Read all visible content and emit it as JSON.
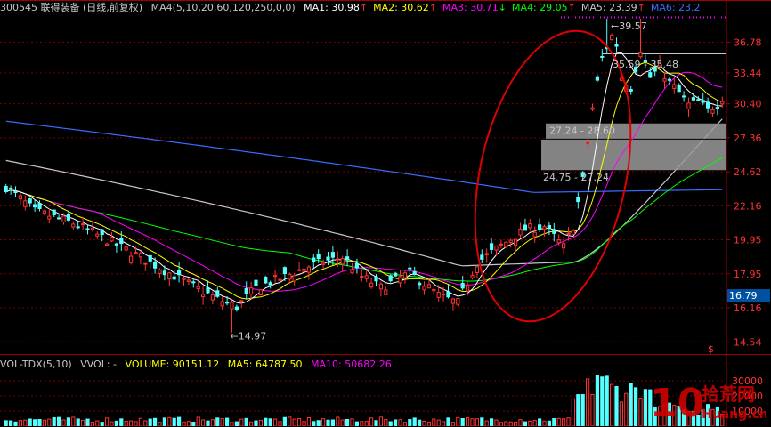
{
  "header": {
    "stock": "300545 联得装备 (日线,前复权)",
    "ma_label": "MA4(5,10,20,60,120,250,0,0)",
    "ma": [
      {
        "text": "MA1: 30.98",
        "arrow": "↑",
        "color": "#ffffff"
      },
      {
        "text": "MA2: 30.62",
        "arrow": "↑",
        "color": "#ffff00"
      },
      {
        "text": "MA3: 30.71",
        "arrow": "↓",
        "color": "#ff00ff"
      },
      {
        "text": "MA4: 29.05",
        "arrow": "↑",
        "color": "#00ff00"
      },
      {
        "text": "MA5: 23.39",
        "arrow": "↑",
        "color": "#c8c8c8"
      },
      {
        "text": "MA6: 23.2",
        "arrow": "",
        "color": "#3a6cff"
      }
    ]
  },
  "volume_header": {
    "label": "VOL-TDX(5,10)",
    "vvol": "VVOL: -",
    "volume": "VOLUME: 90151.12",
    "ma5": "MA5: 64787.50",
    "ma10": "MA10: 50682.26"
  },
  "price_axis": {
    "ticks": [
      "36.78",
      "33.44",
      "30.40",
      "27.36",
      "24.62",
      "22.16",
      "19.95",
      "17.95",
      "16.16",
      "14.54"
    ],
    "current": "16.79",
    "unit": "$"
  },
  "volume_axis": {
    "ticks": [
      "30000",
      "20000",
      "10000"
    ]
  },
  "annotations": {
    "high": "39.57",
    "low": "14.97",
    "zone1": "35.59 - 35.48",
    "zone2": "27.24 - 28.60",
    "zone3": "24.75 - 27.24"
  },
  "watermark": {
    "text": "拾荒网",
    "sub": "Huang.cn"
  },
  "colors": {
    "up": "#ff3232",
    "down": "#54ffff",
    "grid": "#7a0000",
    "circle": "#e00000"
  },
  "chart_data": {
    "type": "candlestick",
    "title": "300545 联得装备 (日线,前复权)",
    "ylim": [
      14.0,
      40.0
    ],
    "y_scale": "log",
    "ohlc_summary": {
      "low_point": 14.97,
      "high_point": 39.57,
      "last_close": 30.98
    },
    "moving_averages": {
      "MA5": 30.98,
      "MA10": 30.62,
      "MA20": 30.71,
      "MA60": 29.05,
      "MA120": 23.39,
      "MA250": 23.2
    },
    "zones": [
      {
        "range": [
          35.48,
          35.59
        ]
      },
      {
        "range": [
          27.24,
          28.6
        ]
      },
      {
        "range": [
          24.75,
          27.24
        ]
      }
    ],
    "volume": {
      "VOLUME": 90151.12,
      "MA5": 64787.5,
      "MA10": 50682.26
    }
  }
}
